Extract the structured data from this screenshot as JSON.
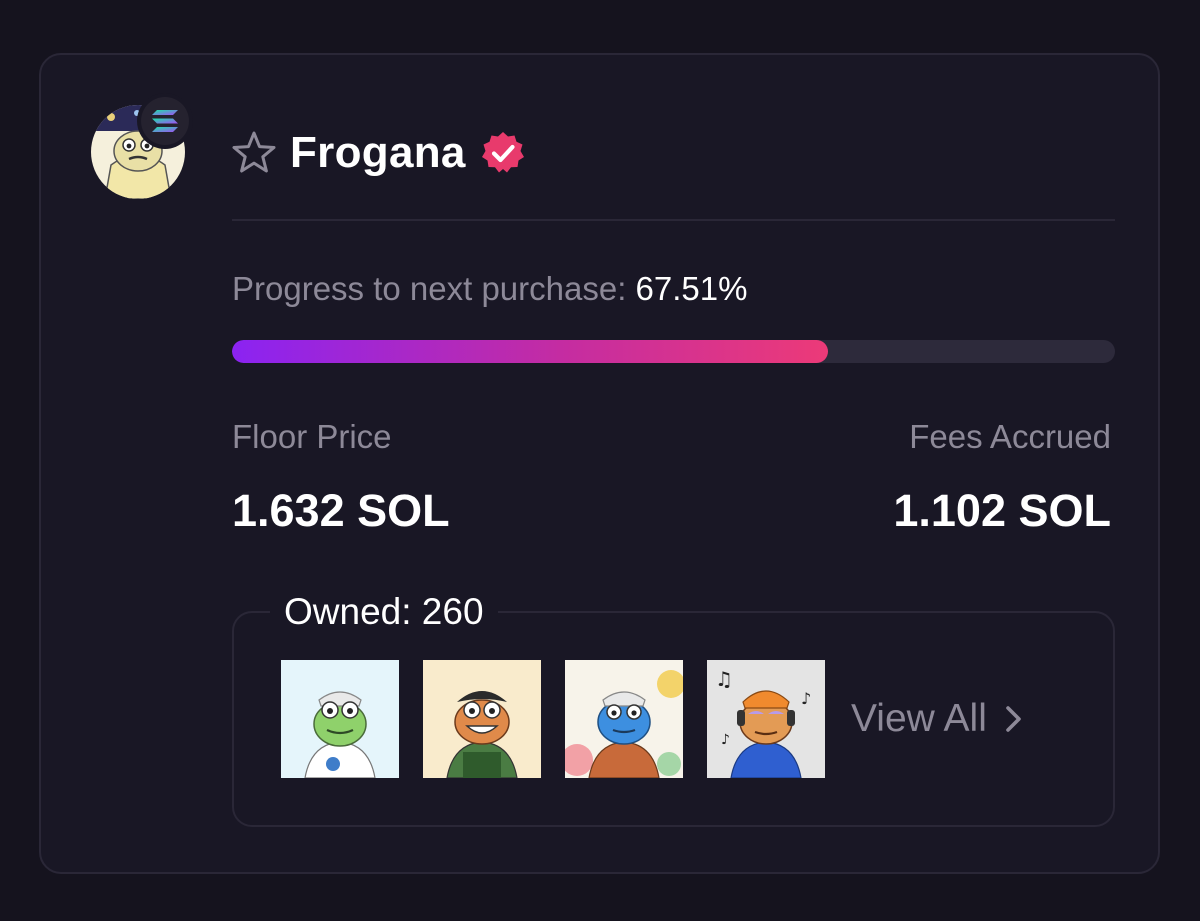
{
  "collection": {
    "name": "Frogana",
    "verified": true,
    "chain_icon": "solana-logo-icon",
    "avatar_icon": "frog-avatar-image"
  },
  "progress": {
    "label": "Progress to next purchase:",
    "value_text": "67.51%",
    "fraction": 0.6751
  },
  "stats": {
    "floor_price_label": "Floor Price",
    "floor_price_value": "1.632 SOL",
    "fees_accrued_label": "Fees Accrued",
    "fees_accrued_value": "1.102 SOL"
  },
  "owned": {
    "label": "Owned: 260",
    "view_all_label": "View All",
    "thumbnails": [
      {
        "icon": "frog-nft-green"
      },
      {
        "icon": "frog-nft-orange"
      },
      {
        "icon": "frog-nft-blue"
      },
      {
        "icon": "frog-nft-orange-headphones"
      }
    ]
  },
  "colors": {
    "background": "#15131e",
    "card": "#191725",
    "border": "#2a2737",
    "muted_text": "#8d8998",
    "gradient_start": "#8b23f2",
    "gradient_end": "#ec3a78",
    "verified_badge": "#e83a6c"
  }
}
